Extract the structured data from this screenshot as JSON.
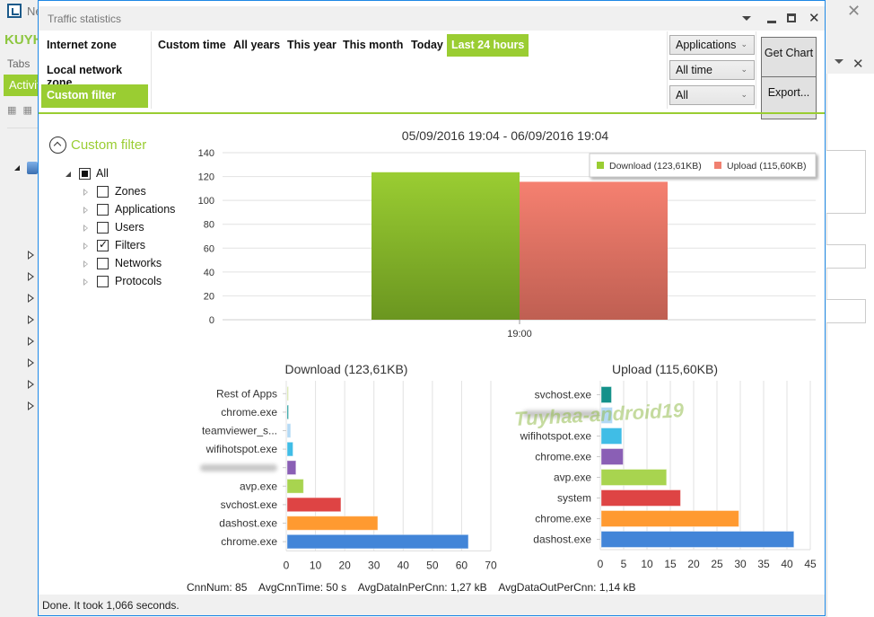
{
  "background_window": {
    "title_partial": "Ne",
    "brand_partial": "KUYH",
    "tabs_label": "Tabs",
    "activity_tab_partial": "Activit"
  },
  "dialog": {
    "title": "Traffic statistics"
  },
  "zones": [
    {
      "label": "Internet zone",
      "active": false
    },
    {
      "label": "Local network zone",
      "active": false
    },
    {
      "label": "Custom filter",
      "active": true
    }
  ],
  "time_ranges": [
    {
      "label": "Custom time",
      "active": false
    },
    {
      "label": "All years",
      "active": false
    },
    {
      "label": "This year",
      "active": false
    },
    {
      "label": "This month",
      "active": false
    },
    {
      "label": "Today",
      "active": false
    },
    {
      "label": "Last 24 hours",
      "active": true
    }
  ],
  "combos": {
    "group_by": "Applications",
    "period": "All time",
    "direction": "All"
  },
  "buttons": {
    "get_chart": "Get Chart",
    "export": "Export..."
  },
  "filter": {
    "title": "Custom filter",
    "root": {
      "label": "All",
      "state": "partial"
    },
    "items": [
      {
        "label": "Zones",
        "checked": false
      },
      {
        "label": "Applications",
        "checked": false
      },
      {
        "label": "Users",
        "checked": false
      },
      {
        "label": "Filters",
        "checked": true
      },
      {
        "label": "Networks",
        "checked": false
      },
      {
        "label": "Protocols",
        "checked": false
      }
    ]
  },
  "chart_data": [
    {
      "type": "bar",
      "title": "05/09/2016 19:04 - 06/09/2016 19:04",
      "categories": [
        "19:00"
      ],
      "series": [
        {
          "name": "Download (123,61KB)",
          "values": [
            123.61
          ],
          "color": "#9acd32"
        },
        {
          "name": "Upload (115,60KB)",
          "values": [
            115.6
          ],
          "color": "#f08070"
        }
      ],
      "ylim": [
        0,
        140
      ],
      "yticks": [
        0,
        20,
        40,
        60,
        80,
        100,
        120,
        140
      ],
      "xlabel": "",
      "ylabel": "",
      "grid": true,
      "legend": "top-right"
    },
    {
      "type": "bar",
      "orientation": "horizontal",
      "title": "Download (123,61KB)",
      "categories": [
        "Rest of Apps",
        "chrome.exe",
        "teamviewer_s...",
        "wifihotspot.exe",
        "",
        "avp.exe",
        "svchost.exe",
        "dashost.exe",
        "chrome.exe"
      ],
      "values": [
        0.3,
        0.3,
        1.2,
        2.0,
        3.0,
        5.6,
        18.4,
        31.0,
        62.0
      ],
      "colors": [
        "#d6e4a8",
        "#1a9a9a",
        "#b3d9f5",
        "#40bde6",
        "#8a5fb5",
        "#a8d44f",
        "#de4444",
        "#ff9a30",
        "#4285d8"
      ],
      "xlim": [
        0,
        70
      ],
      "xticks": [
        0,
        10,
        20,
        30,
        40,
        50,
        60,
        70
      ],
      "grid": true
    },
    {
      "type": "bar",
      "orientation": "horizontal",
      "title": "Upload (115,60KB)",
      "categories": [
        "svchost.exe",
        "",
        "wifihotspot.exe",
        "chrome.exe",
        "avp.exe",
        "system",
        "chrome.exe",
        "dashost.exe"
      ],
      "values": [
        2.2,
        2.4,
        4.4,
        4.7,
        14.0,
        17.0,
        29.5,
        41.3
      ],
      "colors": [
        "#14918a",
        "#b3d9f5",
        "#40bde6",
        "#8a5fb5",
        "#a8d44f",
        "#de4444",
        "#ff9a30",
        "#4285d8"
      ],
      "xlim": [
        0,
        45
      ],
      "xticks": [
        0,
        5,
        10,
        15,
        20,
        25,
        30,
        35,
        40,
        45
      ],
      "grid": true
    }
  ],
  "stats": {
    "cnn_num": "CnnNum: 85",
    "avg_cnn_time": "AvgCnnTime: 50 s",
    "avg_in": "AvgDataInPerCnn: 1,27 kB",
    "avg_out": "AvgDataOutPerCnn: 1,14 kB"
  },
  "status": "Done. It took 1,066 seconds.",
  "watermark": "Tuyhaa-android19"
}
